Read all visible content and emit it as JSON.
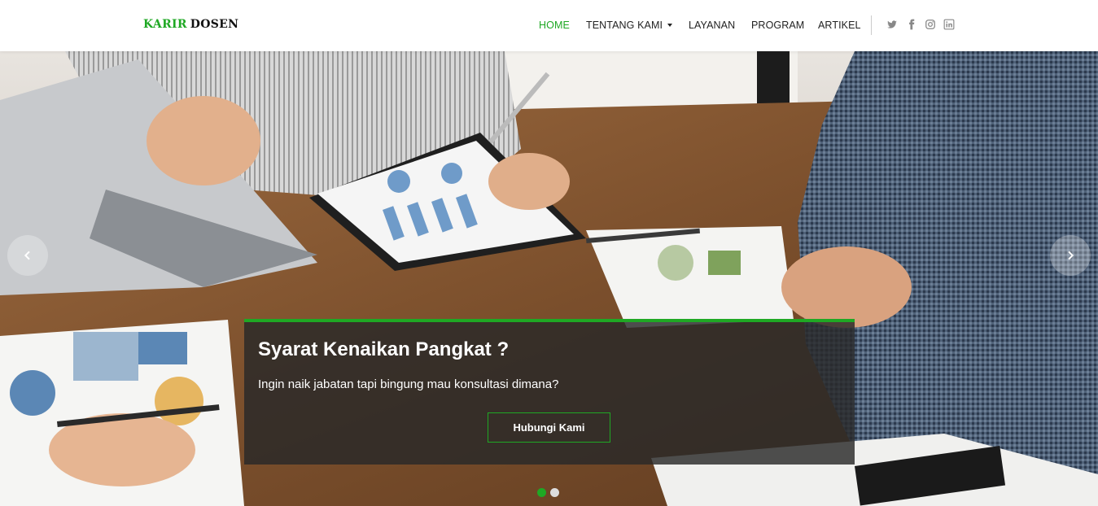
{
  "brand": {
    "part1": "KARIR",
    "part2": "DOSEN"
  },
  "nav": {
    "home": "HOME",
    "tentang": "TENTANG KAMI",
    "layanan": "LAYANAN",
    "program": "PROGRAM",
    "artikel": "ARTIKEL"
  },
  "social": [
    "twitter-icon",
    "facebook-icon",
    "instagram-icon",
    "linkedin-icon"
  ],
  "hero": {
    "title": "Syarat Kenaikan Pangkat ?",
    "subtitle": "Ingin naik jabatan tapi bingung mau konsultasi dimana?",
    "cta": "Hubungi Kami",
    "slide_count": 2,
    "active_slide": 1
  },
  "colors": {
    "accent": "#1fa824",
    "text": "#222222",
    "overlay": "#282828"
  }
}
